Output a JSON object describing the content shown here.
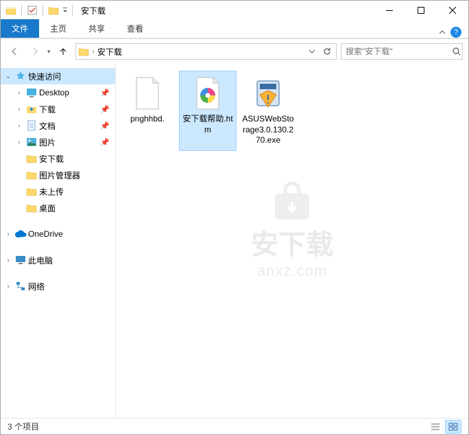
{
  "titlebar": {
    "title": "安下载"
  },
  "ribbon": {
    "file": "文件",
    "tabs": [
      "主页",
      "共享",
      "查看"
    ]
  },
  "addressbar": {
    "path": "安下载"
  },
  "search": {
    "placeholder": "搜索\"安下载\""
  },
  "sidebar": {
    "quick_access": "快速访问",
    "items": [
      {
        "label": "Desktop",
        "pinned": true,
        "icon": "desktop"
      },
      {
        "label": "下载",
        "pinned": true,
        "icon": "downloads"
      },
      {
        "label": "文档",
        "pinned": true,
        "icon": "documents"
      },
      {
        "label": "图片",
        "pinned": true,
        "icon": "pictures"
      },
      {
        "label": "安下载",
        "pinned": false,
        "icon": "folder"
      },
      {
        "label": "图片管理器",
        "pinned": false,
        "icon": "folder"
      },
      {
        "label": "未上传",
        "pinned": false,
        "icon": "folder"
      },
      {
        "label": "桌面",
        "pinned": false,
        "icon": "folder"
      }
    ],
    "onedrive": "OneDrive",
    "this_pc": "此电脑",
    "network": "网络"
  },
  "files": [
    {
      "name": "pnghhbd.",
      "type": "blank",
      "selected": false
    },
    {
      "name": "安下载帮助.htm",
      "type": "htm",
      "selected": true
    },
    {
      "name": "ASUSWebStorage3.0.130.270.exe",
      "type": "exe",
      "selected": false
    }
  ],
  "statusbar": {
    "count": "3 个项目"
  },
  "watermark": {
    "text": "安下载",
    "sub": "anxz.com"
  }
}
